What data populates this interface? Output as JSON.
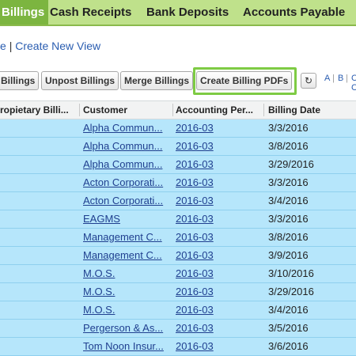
{
  "tabs": [
    {
      "label": "Billings",
      "active": true
    },
    {
      "label": "Cash Receipts",
      "active": false
    },
    {
      "label": "Bank Deposits",
      "active": false
    },
    {
      "label": "Accounts Payable",
      "active": false
    }
  ],
  "view_links": {
    "edit": "e",
    "separator": "|",
    "create": "Create New View"
  },
  "toolbar": {
    "buttons": [
      "Billings",
      "Unpost Billings",
      "Merge Billings",
      "Create Billing PDFs"
    ],
    "refresh_icon": "refresh-icon",
    "alpha": [
      "A",
      "B",
      "C",
      "C"
    ]
  },
  "table": {
    "columns": [
      "ropietary Billi...",
      "Customer",
      "Accounting Per...",
      "Billing Date"
    ],
    "rows": [
      {
        "customer": "Alpha Commun...",
        "period": "2016-03",
        "date": "3/3/2016"
      },
      {
        "customer": "Alpha Commun...",
        "period": "2016-03",
        "date": "3/8/2016"
      },
      {
        "customer": "Alpha Commun...",
        "period": "2016-03",
        "date": "3/29/2016"
      },
      {
        "customer": "Acton Corporati...",
        "period": "2016-03",
        "date": "3/3/2016"
      },
      {
        "customer": "Acton Corporati...",
        "period": "2016-03",
        "date": "3/4/2016"
      },
      {
        "customer": "EAGMS",
        "period": "2016-03",
        "date": "3/3/2016"
      },
      {
        "customer": "Management C...",
        "period": "2016-03",
        "date": "3/8/2016"
      },
      {
        "customer": "Management C...",
        "period": "2016-03",
        "date": "3/9/2016"
      },
      {
        "customer": "M.O.S.",
        "period": "2016-03",
        "date": "3/10/2016"
      },
      {
        "customer": "M.O.S.",
        "period": "2016-03",
        "date": "3/29/2016"
      },
      {
        "customer": "M.O.S.",
        "period": "2016-03",
        "date": "3/4/2016"
      },
      {
        "customer": "Pergerson & As...",
        "period": "2016-03",
        "date": "3/5/2016"
      },
      {
        "customer": "Tom Noon Insur...",
        "period": "2016-03",
        "date": "3/6/2016"
      }
    ]
  },
  "colors": {
    "tab_bar": "#bfe18b",
    "active_tab": "#7cb540",
    "row_bg": "#b6e6fb",
    "highlight": "#7ecb44",
    "link": "#2a5db0"
  }
}
